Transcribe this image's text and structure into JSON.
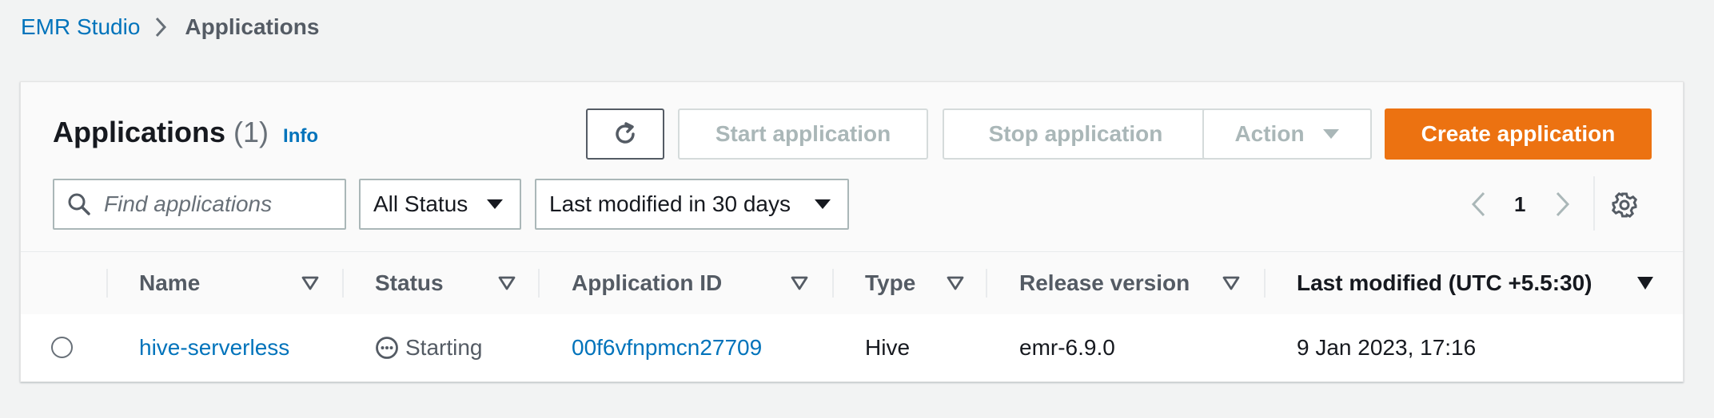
{
  "breadcrumb": {
    "root": "EMR Studio",
    "current": "Applications"
  },
  "panel": {
    "title": "Applications",
    "count": "(1)",
    "info_link": "Info",
    "buttons": {
      "refresh_icon": "refresh-icon",
      "start": "Start application",
      "stop": "Stop application",
      "action": "Action",
      "create": "Create application"
    },
    "search_placeholder": "Find applications",
    "status_filter": "All Status",
    "time_filter": "Last modified in 30 days",
    "pagination": {
      "current_page": "1"
    }
  },
  "table": {
    "columns": [
      "Name",
      "Status",
      "Application ID",
      "Type",
      "Release version",
      "Last modified (UTC +5.5:30)"
    ],
    "rows": [
      {
        "name": "hive-serverless",
        "status": "Starting",
        "application_id": "00f6vfnpmcn27709",
        "type": "Hive",
        "release_version": "emr-6.9.0",
        "last_modified": "9 Jan 2023, 17:16"
      }
    ]
  },
  "colors": {
    "link": "#0073bb",
    "primary_button": "#ec7211",
    "disabled_text": "#aab7b8",
    "background": "#f2f3f3"
  }
}
